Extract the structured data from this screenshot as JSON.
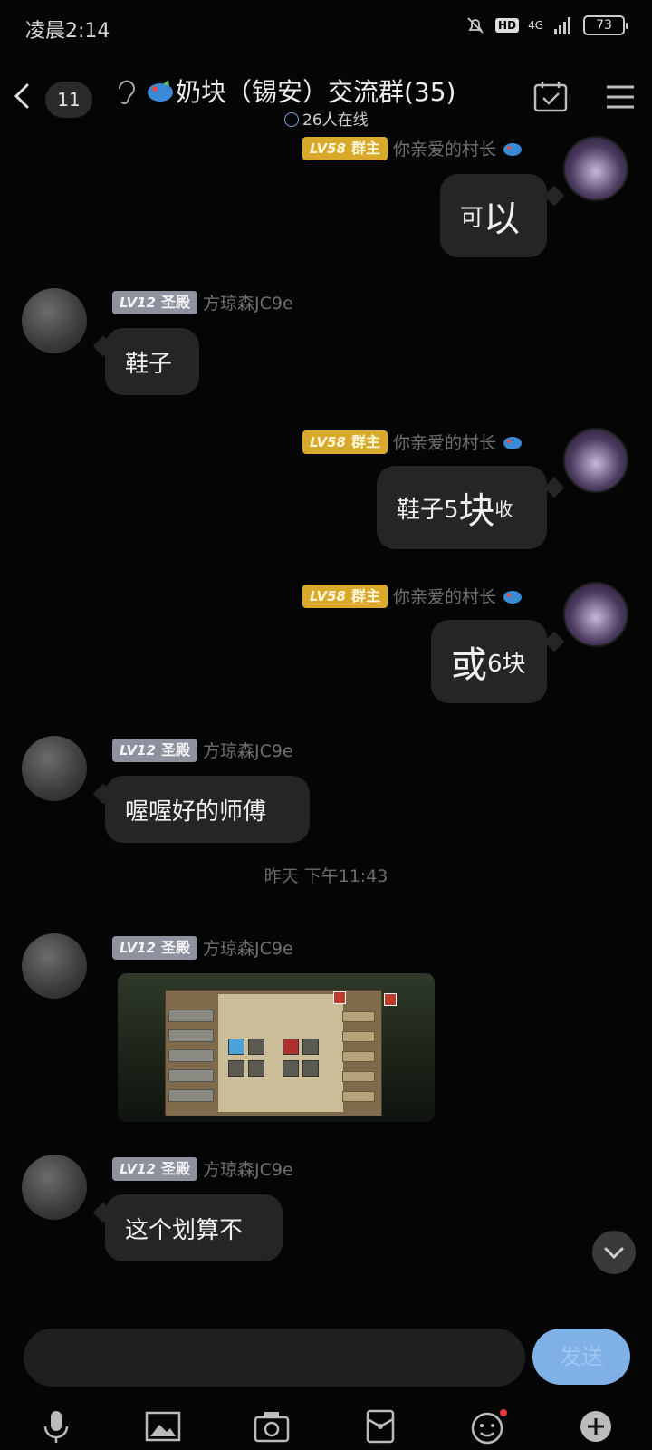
{
  "status_bar": {
    "time": "凌晨2:14",
    "network": "4G",
    "hd_label": "HD",
    "battery": "73"
  },
  "header": {
    "unread_count": "11",
    "group_title": "奶块（锡安）交流群(35)",
    "online_text": "26人在线"
  },
  "messages": [
    {
      "side": "right",
      "level": "LV58",
      "role": "群主",
      "sender": "你亲爱的村长",
      "parts": [
        "可",
        "以"
      ]
    },
    {
      "side": "left",
      "level": "LV12",
      "role": "圣殿",
      "sender": "方琼森JC9e",
      "text": "鞋子"
    },
    {
      "side": "right",
      "level": "LV58",
      "role": "群主",
      "sender": "你亲爱的村长",
      "parts": [
        "鞋子5",
        "块",
        "收"
      ]
    },
    {
      "side": "right",
      "level": "LV58",
      "role": "群主",
      "sender": "你亲爱的村长",
      "parts": [
        "或",
        "6块"
      ]
    },
    {
      "side": "left",
      "level": "LV12",
      "role": "圣殿",
      "sender": "方琼森JC9e",
      "text": "喔喔好的师傅"
    },
    {
      "side": "left",
      "level": "LV12",
      "role": "圣殿",
      "sender": "方琼森JC9e",
      "image": "game-trade-screenshot"
    },
    {
      "side": "left",
      "level": "LV12",
      "role": "圣殿",
      "sender": "方琼森JC9e",
      "text": "这个划算不"
    }
  ],
  "timestamp": "昨天 下午11:43",
  "input": {
    "placeholder": "",
    "send_label": "发送"
  },
  "toolbar": [
    "microphone-icon",
    "image-icon",
    "camera-icon",
    "red-packet-icon",
    "emoji-icon",
    "plus-icon"
  ],
  "colors": {
    "background": "#050505",
    "bubble": "#252525",
    "send": "#7fb0e6",
    "level_gold": "#d9a92c",
    "level_grey": "#8e929e"
  }
}
